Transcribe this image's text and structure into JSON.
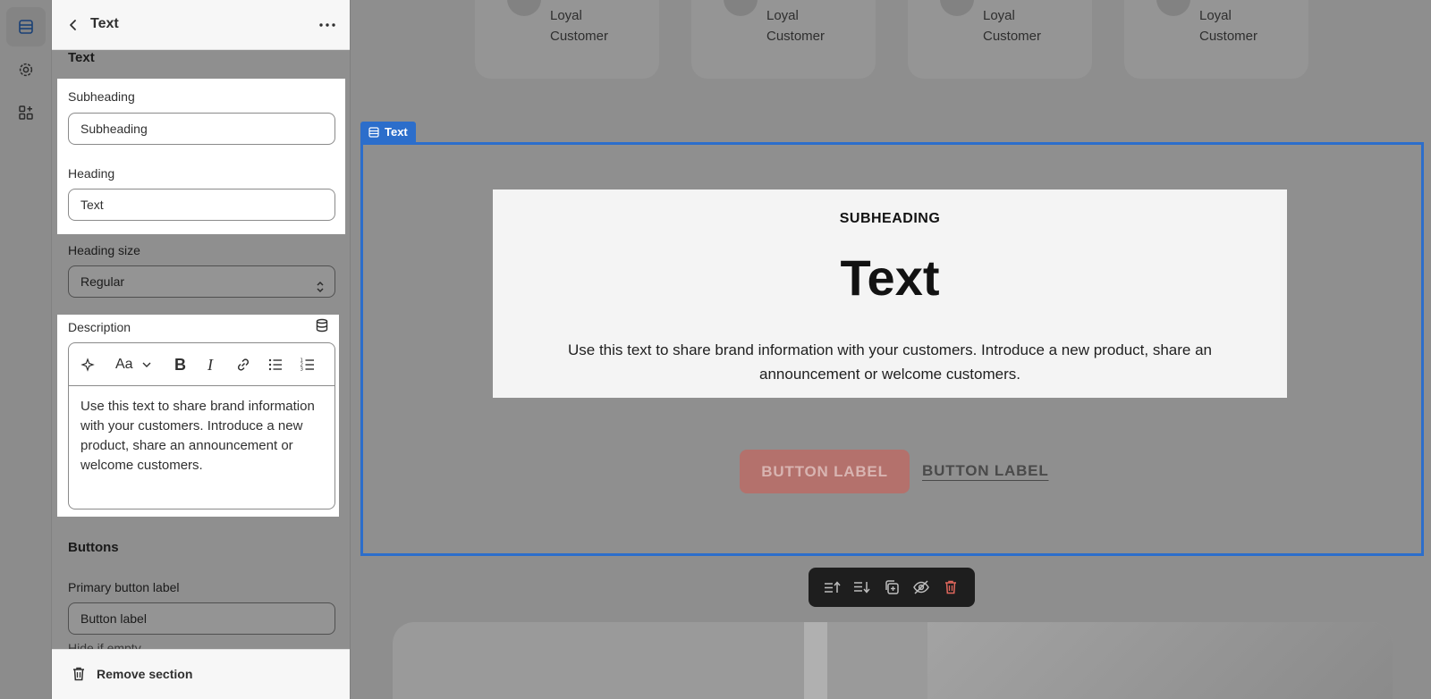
{
  "panel": {
    "title": "Text",
    "section_heading": "Text",
    "subheading_label": "Subheading",
    "subheading_value": "Subheading",
    "heading_label": "Heading",
    "heading_value": "Text",
    "heading_size_label": "Heading size",
    "heading_size_value": "Regular",
    "description_label": "Description",
    "font_menu_label": "Aa",
    "description_text": "Use this text to share brand information with your customers. Introduce a new product, share an announcement or welcome customers.",
    "buttons_heading": "Buttons",
    "primary_button_label": "Primary button label",
    "primary_button_value": "Button label",
    "hide_if_empty": "Hide if empty",
    "remove_section": "Remove section"
  },
  "preview": {
    "testimonial_cards": [
      {
        "name_line1": "Loyal",
        "name_line2": "Customer"
      },
      {
        "name_line1": "Loyal",
        "name_line2": "Customer"
      },
      {
        "name_line1": "Loyal",
        "name_line2": "Customer"
      },
      {
        "name_line1": "Loyal",
        "name_line2": "Customer"
      }
    ],
    "section_tag": "Text",
    "subheading": "SUBHEADING",
    "title": "Text",
    "description": "Use this text to share brand information with your customers. Introduce a new product, share an announcement or welcome customers.",
    "primary_button": "BUTTON LABEL",
    "secondary_button": "BUTTON LABEL"
  },
  "colors": {
    "accent": "#2c6ecb",
    "primary_button": "#b4716c",
    "toolbar_bg": "#1e1e1e",
    "delete": "#e0675c"
  },
  "icons": {
    "rail": [
      "sections-icon",
      "settings-icon",
      "apps-icon"
    ],
    "toolbar": [
      "sparkle-icon",
      "bold-icon",
      "italic-icon",
      "link-icon",
      "bullet-list-icon",
      "numbered-list-icon"
    ],
    "floating": [
      "move-up-icon",
      "move-down-icon",
      "duplicate-icon",
      "hide-icon",
      "delete-icon"
    ]
  }
}
